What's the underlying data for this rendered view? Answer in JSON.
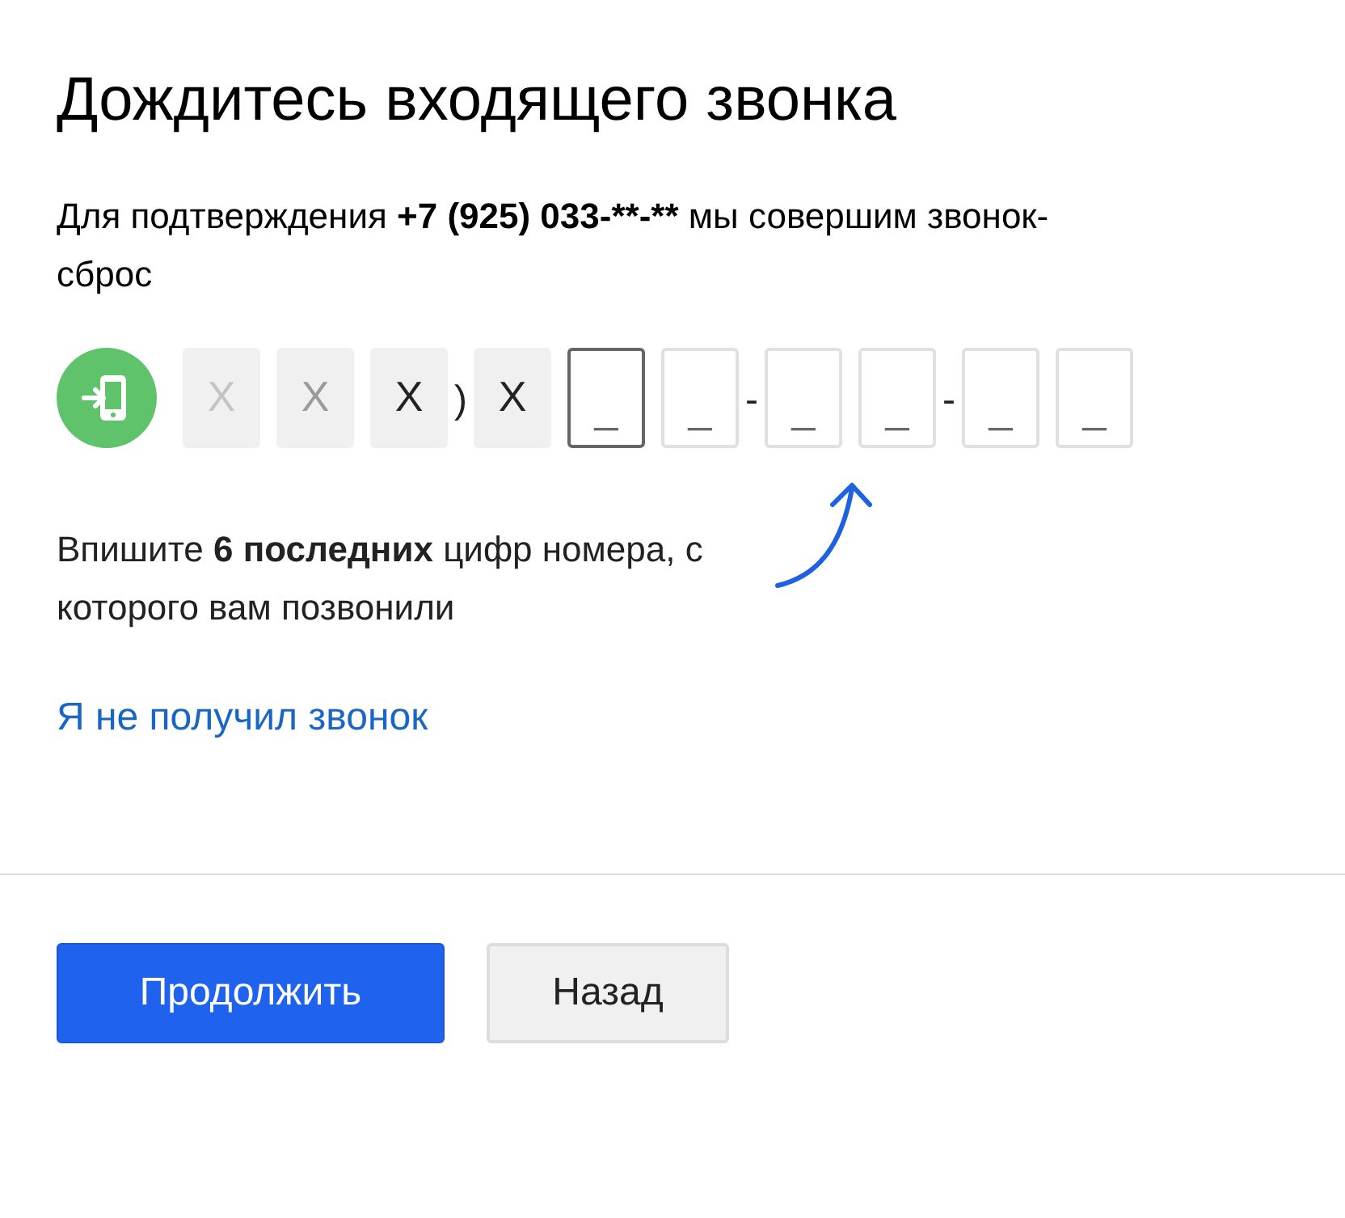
{
  "title": "Дождитесь входящего звонка",
  "intro": {
    "before": "Для подтверждения ",
    "phone": "+7 (925) 033-**-**",
    "after": " мы совершим звонок-сброс"
  },
  "code_slots": [
    {
      "kind": "mask",
      "text": "X",
      "color": "#c4c4c4"
    },
    {
      "kind": "mask",
      "text": "X",
      "color": "#9a9a9a"
    },
    {
      "kind": "mask",
      "text": "X",
      "color": "#222222"
    },
    {
      "kind": "separator",
      "text": ")"
    },
    {
      "kind": "mask",
      "text": "X",
      "color": "#222222"
    },
    {
      "kind": "input",
      "placeholder": "_",
      "selected": true
    },
    {
      "kind": "input",
      "placeholder": "_",
      "selected": false
    },
    {
      "kind": "separator",
      "text": "-"
    },
    {
      "kind": "input",
      "placeholder": "_",
      "selected": false
    },
    {
      "kind": "input",
      "placeholder": "_",
      "selected": false
    },
    {
      "kind": "separator",
      "text": "-"
    },
    {
      "kind": "input",
      "placeholder": "_",
      "selected": false
    },
    {
      "kind": "input",
      "placeholder": "_",
      "selected": false
    }
  ],
  "hint": "Впишите **6 последних** цифр номера, с которого вам позвонили",
  "link": "Я не получил звонок",
  "buttons": [
    {
      "label": "Продолжить",
      "kind": "primary"
    },
    {
      "label": "Назад",
      "kind": "secondary"
    }
  ]
}
